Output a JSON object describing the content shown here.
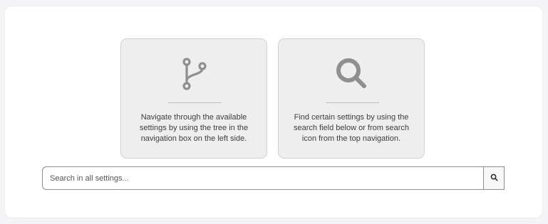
{
  "cards": [
    {
      "icon": "branch-icon",
      "text": "Navigate through the available settings by using the tree in the navigation box on the left side."
    },
    {
      "icon": "search-icon",
      "text": "Find certain settings by using the search field below or from search icon from the top navigation."
    }
  ],
  "search": {
    "placeholder": "Search in all settings...",
    "value": "",
    "button_icon": "search-icon"
  },
  "colors": {
    "icon": "#8f8f8f",
    "card_bg": "#eeeeee",
    "text": "#3d3d3d"
  }
}
